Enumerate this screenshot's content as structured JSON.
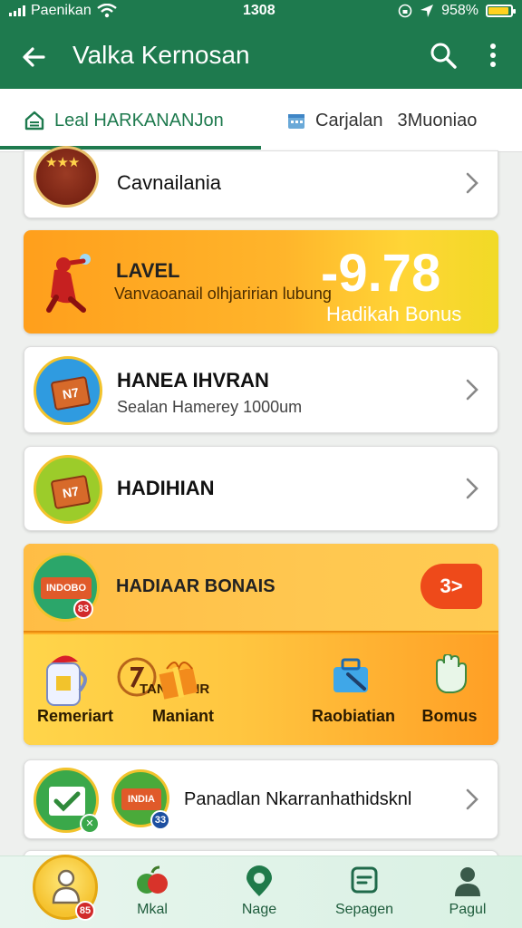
{
  "status": {
    "carrier": "Paenikan",
    "time": "1308",
    "battery": "958%",
    "battery_level": 0.86
  },
  "appbar": {
    "title": "Valka Kernosan"
  },
  "tabs": [
    {
      "label": "Leal HARKANANJon",
      "active": true
    },
    {
      "label": "Carjalan",
      "extra": "3Muoniao",
      "active": false
    }
  ],
  "rows": {
    "row1": {
      "label": "Cavnailania"
    },
    "level": {
      "title": "LAVEL",
      "subtitle": "Vanvaoanail olhjaririan lubung",
      "value": "-9.78",
      "value_label": "Hadikah Bonus"
    },
    "row3": {
      "title": "HANEA IHVRAN",
      "subtitle": "Sealan Hamerey 1000um"
    },
    "row4": {
      "title": "HADIHIAN"
    },
    "bonus": {
      "title": "HADIAAR BONAIS",
      "pill": "3",
      "rewards": [
        {
          "label": "Remeriart"
        },
        {
          "label": "Maniant",
          "caption": "TAN EGNR"
        },
        {
          "label": "Raobiatian"
        },
        {
          "label": "Bomus"
        }
      ]
    },
    "row6": {
      "label": "Panadlan Nkarranhathidsknl"
    }
  },
  "bottom_nav": [
    {
      "label": "Mkal"
    },
    {
      "label": "Nage"
    },
    {
      "label": "Sepagen"
    },
    {
      "label": "Pagul"
    }
  ],
  "colors": {
    "primary": "#1e7a4e",
    "accent_orange": "#ffa318",
    "badge_red": "#d12a2a"
  }
}
